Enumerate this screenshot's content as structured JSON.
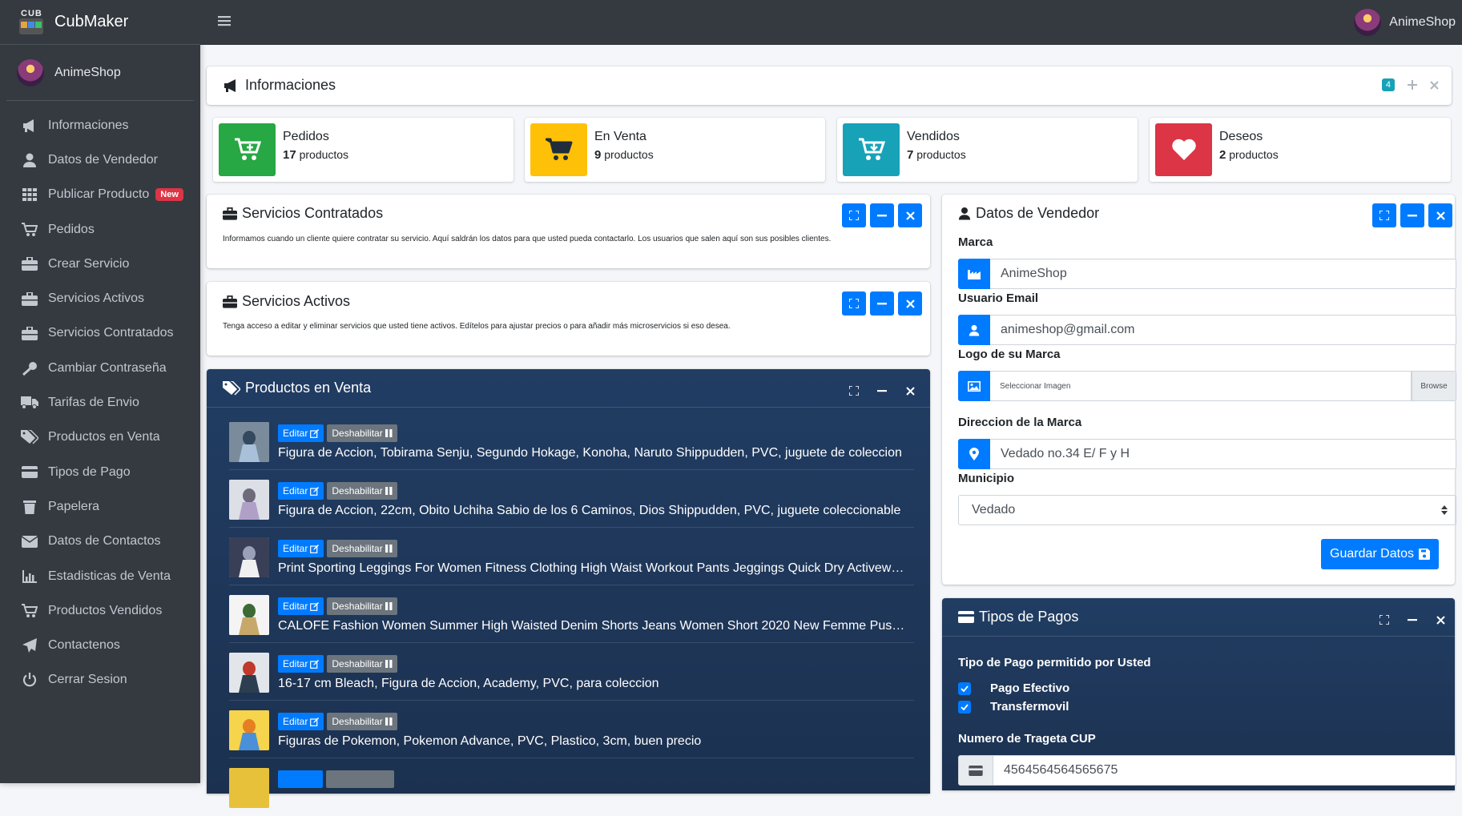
{
  "brand": {
    "name": "CubMaker",
    "logo_text": "CUB"
  },
  "user": {
    "name": "AnimeShop"
  },
  "sidebar": {
    "items": [
      {
        "label": "Informaciones",
        "icon": "megaphone-icon"
      },
      {
        "label": "Datos de Vendedor",
        "icon": "user-icon"
      },
      {
        "label": "Publicar Producto",
        "icon": "grid-icon",
        "badge": "New"
      },
      {
        "label": "Pedidos",
        "icon": "cart-plus-icon"
      },
      {
        "label": "Crear Servicio",
        "icon": "briefcase-icon"
      },
      {
        "label": "Servicios Activos",
        "icon": "briefcase-icon"
      },
      {
        "label": "Servicios Contratados",
        "icon": "briefcase-icon"
      },
      {
        "label": "Cambiar Contraseña",
        "icon": "key-icon"
      },
      {
        "label": "Tarifas de Envio",
        "icon": "truck-icon"
      },
      {
        "label": "Productos en Venta",
        "icon": "tags-icon"
      },
      {
        "label": "Tipos de Pago",
        "icon": "credit-card-icon"
      },
      {
        "label": "Papelera",
        "icon": "trash-icon"
      },
      {
        "label": "Datos de Contactos",
        "icon": "envelope-icon"
      },
      {
        "label": "Estadisticas de Venta",
        "icon": "chart-icon"
      },
      {
        "label": "Productos Vendidos",
        "icon": "cart-plus-icon"
      },
      {
        "label": "Contactenos",
        "icon": "paper-plane-icon"
      },
      {
        "label": "Cerrar Sesion",
        "icon": "power-icon"
      }
    ]
  },
  "info": {
    "title": "Informaciones",
    "badge": "4",
    "boxes": [
      {
        "label": "Pedidos",
        "count": "17",
        "unit": "productos",
        "color": "#28a745",
        "icon": "cart-plus-icon"
      },
      {
        "label": "En Venta",
        "count": "9",
        "unit": "productos",
        "color": "#ffc107",
        "icon": "cart-icon"
      },
      {
        "label": "Vendidos",
        "count": "7",
        "unit": "productos",
        "color": "#17a2b8",
        "icon": "cart-download-icon"
      },
      {
        "label": "Deseos",
        "count": "2",
        "unit": "productos",
        "color": "#dc3545",
        "icon": "heart-icon"
      }
    ]
  },
  "servicios_contratados": {
    "title": "Servicios Contratados",
    "text": "Informamos cuando un cliente quiere contratar su servicio. Aquí saldrán los datos para que usted pueda contactarlo. Los usuarios que salen aquí son sus posibles clientes."
  },
  "servicios_activos": {
    "title": "Servicios Activos",
    "text": "Tenga acceso a editar y eliminar servicios que usted tiene activos. Edítelos para ajustar precios o para añadir más microservicios si eso desea."
  },
  "productos": {
    "title": "Productos en Venta",
    "edit_label": "Editar",
    "disable_label": "Deshabilitar",
    "items": [
      {
        "title": "Figura de Accion, Tobirama Senju, Segundo Hokage, Konoha, Naruto Shippudden, PVC, juguete de coleccion"
      },
      {
        "title": "Figura de Accion, 22cm, Obito Uchiha Sabio de los 6 Caminos, Dios Shippudden, PVC, juguete coleccionable"
      },
      {
        "title": "Print Sporting Leggings For Women Fitness Clothing High Waist Workout Pants Jeggings Quick Dry Activewea..."
      },
      {
        "title": "CALOFE Fashion Women Summer High Waisted Denim Shorts Jeans Women Short 2020 New Femme Push Up..."
      },
      {
        "title": "16-17 cm Bleach, Figura de Accion, Academy, PVC, para coleccion"
      },
      {
        "title": "Figuras de Pokemon, Pokemon Advance, PVC, Plastico, 3cm, buen precio"
      }
    ]
  },
  "vendedor": {
    "title": "Datos de Vendedor",
    "marca_label": "Marca",
    "marca_value": "AnimeShop",
    "email_label": "Usuario Email",
    "email_value": "animeshop@gmail.com",
    "logo_label": "Logo de su Marca",
    "logo_placeholder": "Seleccionar Imagen",
    "browse_label": "Browse",
    "direccion_label": "Direccion de la Marca",
    "direccion_value": "Vedado no.34 E/ F y H",
    "municipio_label": "Municipio",
    "municipio_value": "Vedado",
    "save_label": "Guardar Datos"
  },
  "pagos": {
    "title": "Tipos de Pagos",
    "subtitle": "Tipo de Pago permitido por Usted",
    "options": [
      {
        "label": "Pago Efectivo",
        "checked": true
      },
      {
        "label": "Transfermovil",
        "checked": true
      }
    ],
    "cup_label": "Numero de Trageta CUP",
    "cup_value": "4564564564565675"
  },
  "colors": {
    "primary": "#007bff",
    "sidebar": "#343a40",
    "dark_card": "#1f3a5c"
  }
}
